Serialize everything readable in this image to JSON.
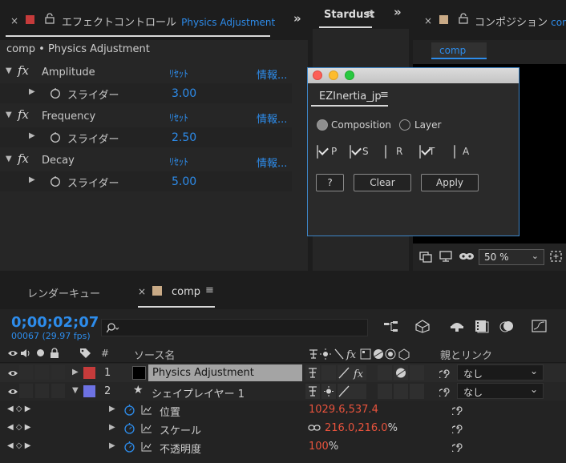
{
  "effects_panel": {
    "title_prefix": "エフェクトコントロール",
    "title_layer": "Physics Adjustment",
    "breadcrumb": "comp • Physics Adjustment",
    "effects": [
      {
        "name": "Amplitude",
        "reset": "ﾘｾｯﾄ",
        "info": "情報...",
        "param": "スライダー",
        "value": "3.00"
      },
      {
        "name": "Frequency",
        "reset": "ﾘｾｯﾄ",
        "info": "情報...",
        "param": "スライダー",
        "value": "2.50"
      },
      {
        "name": "Decay",
        "reset": "ﾘｾｯﾄ",
        "info": "情報...",
        "param": "スライダー",
        "value": "5.00"
      }
    ]
  },
  "stardust_panel": {
    "title": "Stardust"
  },
  "composition_panel": {
    "title": "コンポジション",
    "title_tail": "com",
    "tab": "comp",
    "zoom": "50 %"
  },
  "dialog": {
    "title": "EZInertia_jp",
    "radios": [
      "Composition",
      "Layer"
    ],
    "checks": [
      {
        "label": "P",
        "checked": true
      },
      {
        "label": "S",
        "checked": true
      },
      {
        "label": "R",
        "checked": false
      },
      {
        "label": "T",
        "checked": true
      },
      {
        "label": "A",
        "checked": false
      }
    ],
    "help_btn": "?",
    "clear_btn": "Clear",
    "apply_btn": "Apply"
  },
  "timeline": {
    "render_queue_tab": "レンダーキュー",
    "comp_tab": "comp",
    "timecode": "0;00;02;07",
    "frames": "00067 (29.97 fps)",
    "search_placeholder": "",
    "col_num": "#",
    "col_source": "ソース名",
    "col_parent": "親とリンク",
    "layers": [
      {
        "num": "1",
        "name": "Physics Adjustment",
        "color": "#c63b3b",
        "parent": "なし"
      },
      {
        "num": "2",
        "name": "シェイプレイヤー 1",
        "color": "#6d72e3",
        "parent": "なし"
      }
    ],
    "properties": [
      {
        "name": "位置",
        "value": "1029.6,537.4"
      },
      {
        "name": "スケール",
        "value": "216.0,216.0",
        "suffix": "%"
      },
      {
        "name": "不透明度",
        "value": "100",
        "suffix": "%"
      }
    ]
  }
}
